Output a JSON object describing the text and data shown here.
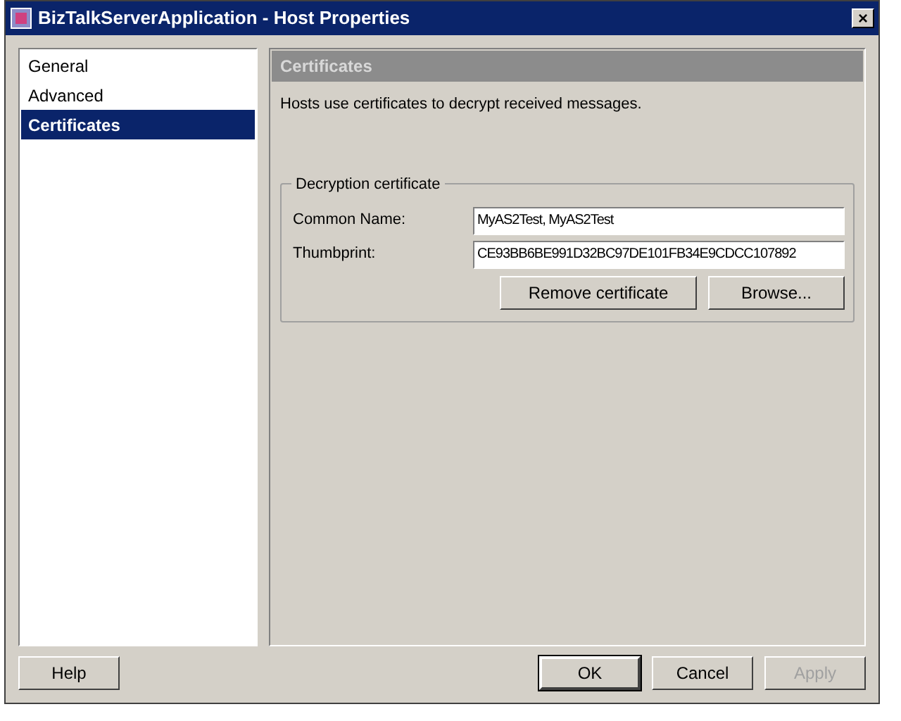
{
  "window": {
    "title": "BizTalkServerApplication - Host Properties",
    "close": "×"
  },
  "sidebar": {
    "items": [
      {
        "label": "General",
        "selected": false
      },
      {
        "label": "Advanced",
        "selected": false
      },
      {
        "label": "Certificates",
        "selected": true
      }
    ]
  },
  "panel": {
    "header": "Certificates",
    "description": "Hosts use certificates to decrypt received messages.",
    "group": {
      "title": "Decryption certificate",
      "fields": [
        {
          "label": "Common Name:",
          "value": "MyAS2Test, MyAS2Test"
        },
        {
          "label": "Thumbprint:",
          "value": "CE93BB6BE991D32BC97DE101FB34E9CDCC107892"
        }
      ],
      "buttons": [
        {
          "label": "Remove certificate",
          "disabled": false
        },
        {
          "label": "Browse...",
          "disabled": false
        }
      ]
    }
  },
  "footer": {
    "left": [
      {
        "label": "Help",
        "default": false,
        "disabled": false
      }
    ],
    "right": [
      {
        "label": "OK",
        "default": true,
        "disabled": false
      },
      {
        "label": "Cancel",
        "default": false,
        "disabled": false
      },
      {
        "label": "Apply",
        "default": false,
        "disabled": true
      }
    ]
  }
}
